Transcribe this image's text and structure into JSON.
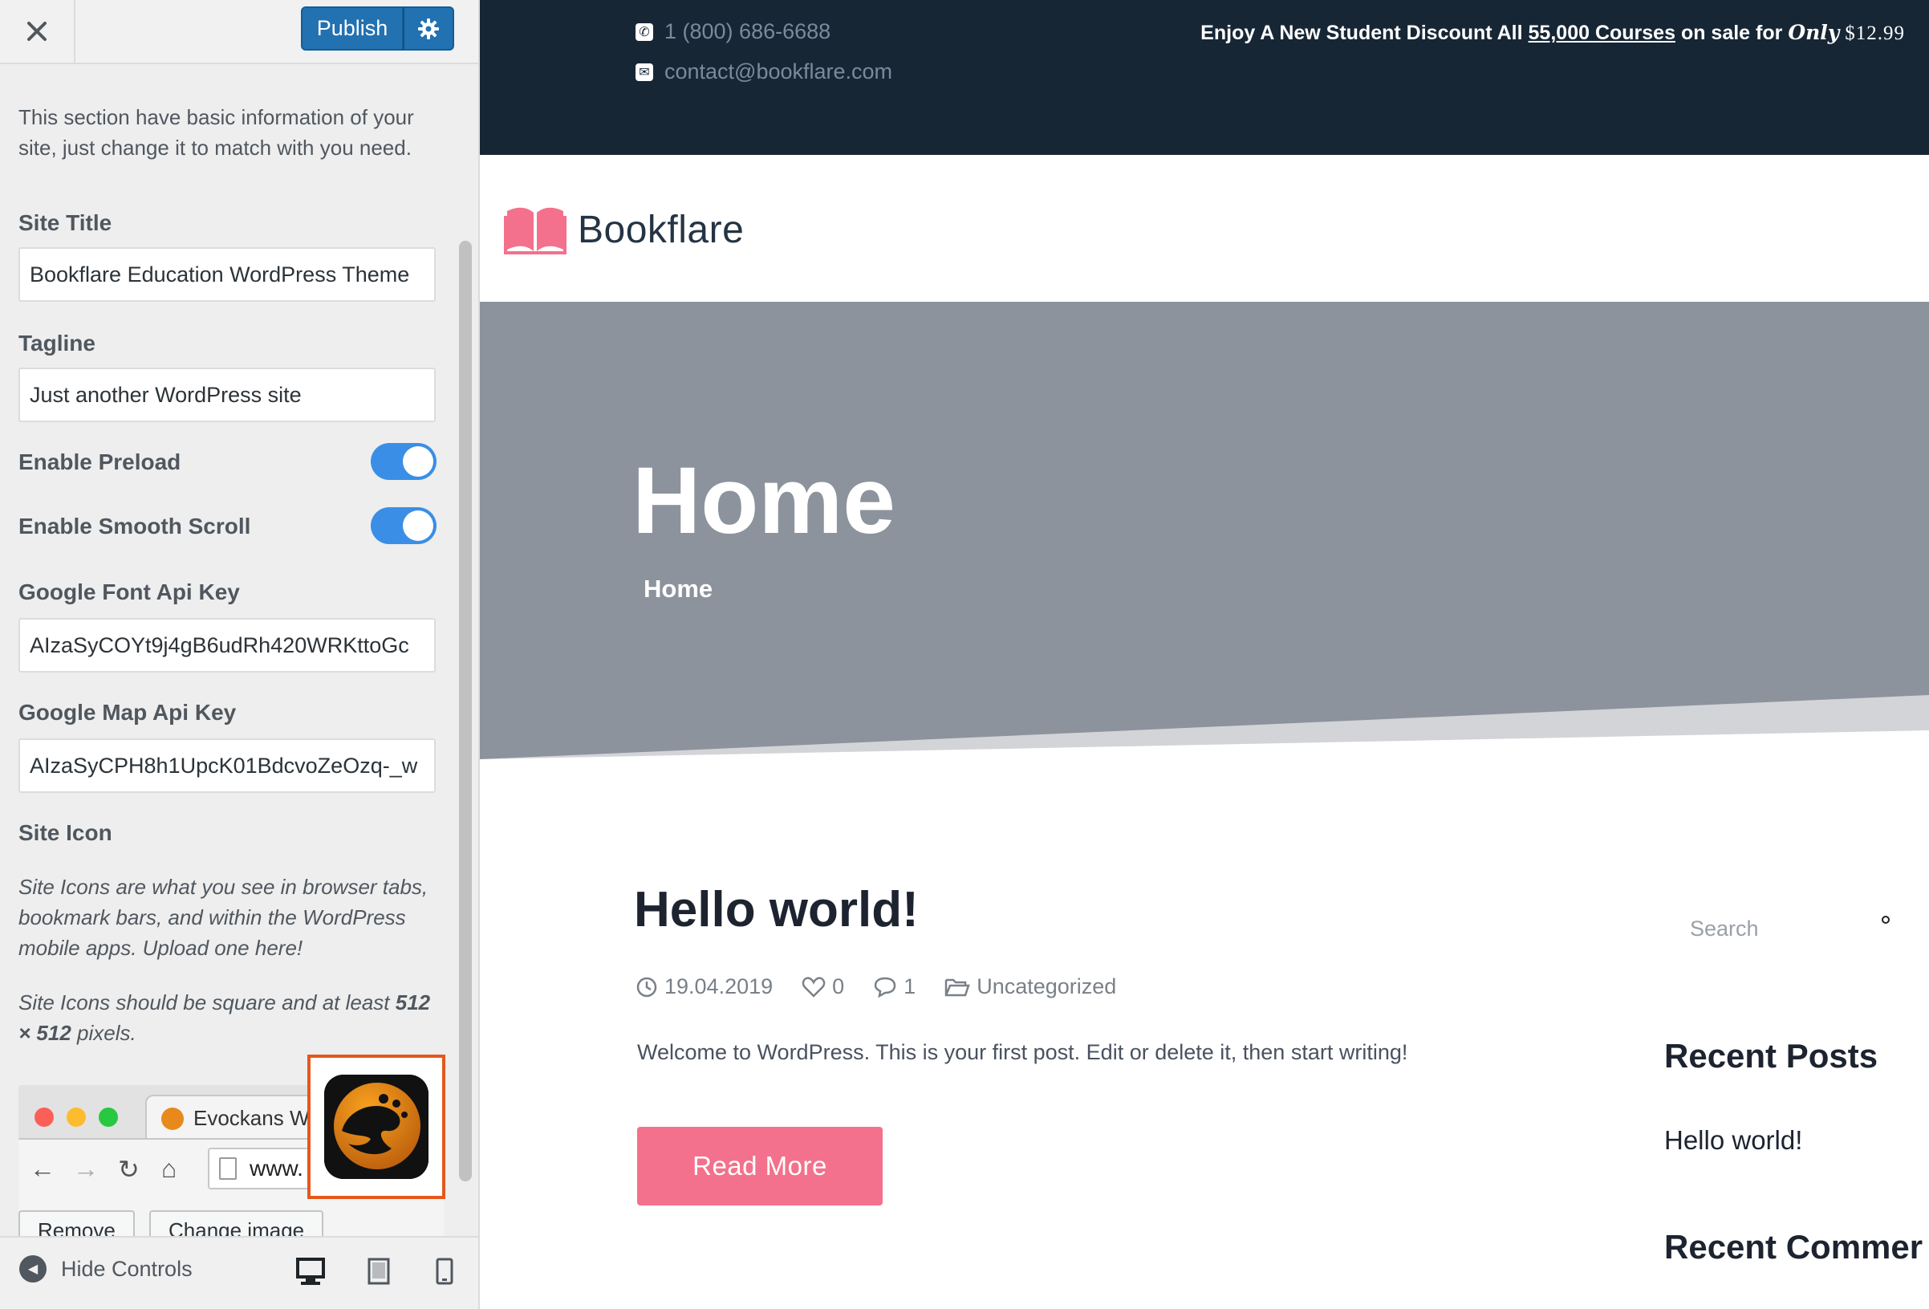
{
  "header": {
    "publish_label": "Publish"
  },
  "section": {
    "description": "This section have basic information of your site, just change it to match with you need.",
    "site_title_label": "Site Title",
    "site_title_value": "Bookflare Education WordPress Theme",
    "tagline_label": "Tagline",
    "tagline_value": "Just another WordPress site",
    "preload_label": "Enable Preload",
    "preload_on": true,
    "smooth_scroll_label": "Enable Smooth Scroll",
    "smooth_scroll_on": true,
    "font_api_label": "Google Font Api Key",
    "font_api_value": "AIzaSyCOYt9j4gB6udRh420WRKttoGc",
    "map_api_label": "Google Map Api Key",
    "map_api_value": "AIzaSyCPH8h1UpcK01BdcvoZeOzq-_w",
    "site_icon_label": "Site Icon",
    "site_icon_desc1": "Site Icons are what you see in browser tabs, bookmark bars, and within the WordPress mobile apps. Upload one here!",
    "site_icon_desc2_prefix": "Site Icons should be square and at least",
    "site_icon_desc2_size": "512 × 512",
    "site_icon_desc2_suffix": "pixels.",
    "browser_tab_title": "Evockans W",
    "browser_address": "www.",
    "remove_label": "Remove",
    "change_image_label": "Change image"
  },
  "footer": {
    "hide_controls_label": "Hide Controls"
  },
  "preview": {
    "phone": "1 (800) 686-6688",
    "email": "contact@bookflare.com",
    "promo_prefix": "Enjoy A New Student Discount All",
    "promo_link": "55,000 Courses",
    "promo_middle": "on sale for",
    "promo_only": "Only",
    "promo_price": "$12.99",
    "logo_text": "Bookflare",
    "hero_title": "Home",
    "breadcrumb": "Home",
    "post_title": "Hello world!",
    "post_date": "19.04.2019",
    "post_likes": "0",
    "post_comments": "1",
    "post_category": "Uncategorized",
    "post_excerpt": "Welcome to WordPress. This is your first post. Edit or delete it, then start writing!",
    "read_more_label": "Read More",
    "search_placeholder": "Search",
    "recent_posts_title": "Recent Posts",
    "recent_post_item": "Hello world!",
    "recent_comments_title": "Recent Commer"
  },
  "colors": {
    "accent_blue": "#2271b1",
    "topbar_bg": "#172635",
    "hero_bg": "#8c939c",
    "brand_pink": "#f3718c",
    "toggle_on": "#3a8ee6"
  }
}
